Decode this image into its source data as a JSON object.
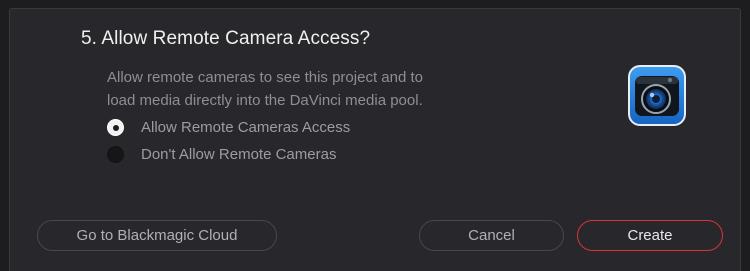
{
  "dialog": {
    "title": "5. Allow Remote Camera Access?",
    "description_line1": "Allow remote cameras to see this project and to",
    "description_line2": "load media directly into the DaVinci media pool."
  },
  "options": [
    {
      "label": "Allow Remote Cameras Access",
      "selected": true
    },
    {
      "label": "Don't Allow Remote Cameras",
      "selected": false
    }
  ],
  "buttons": {
    "cloud": "Go to Blackmagic Cloud",
    "cancel": "Cancel",
    "create": "Create"
  },
  "icon": "camera-app-icon",
  "colors": {
    "accent": "#d8323b",
    "icon_blue": "#1d7fd6",
    "background": "#28282c"
  }
}
